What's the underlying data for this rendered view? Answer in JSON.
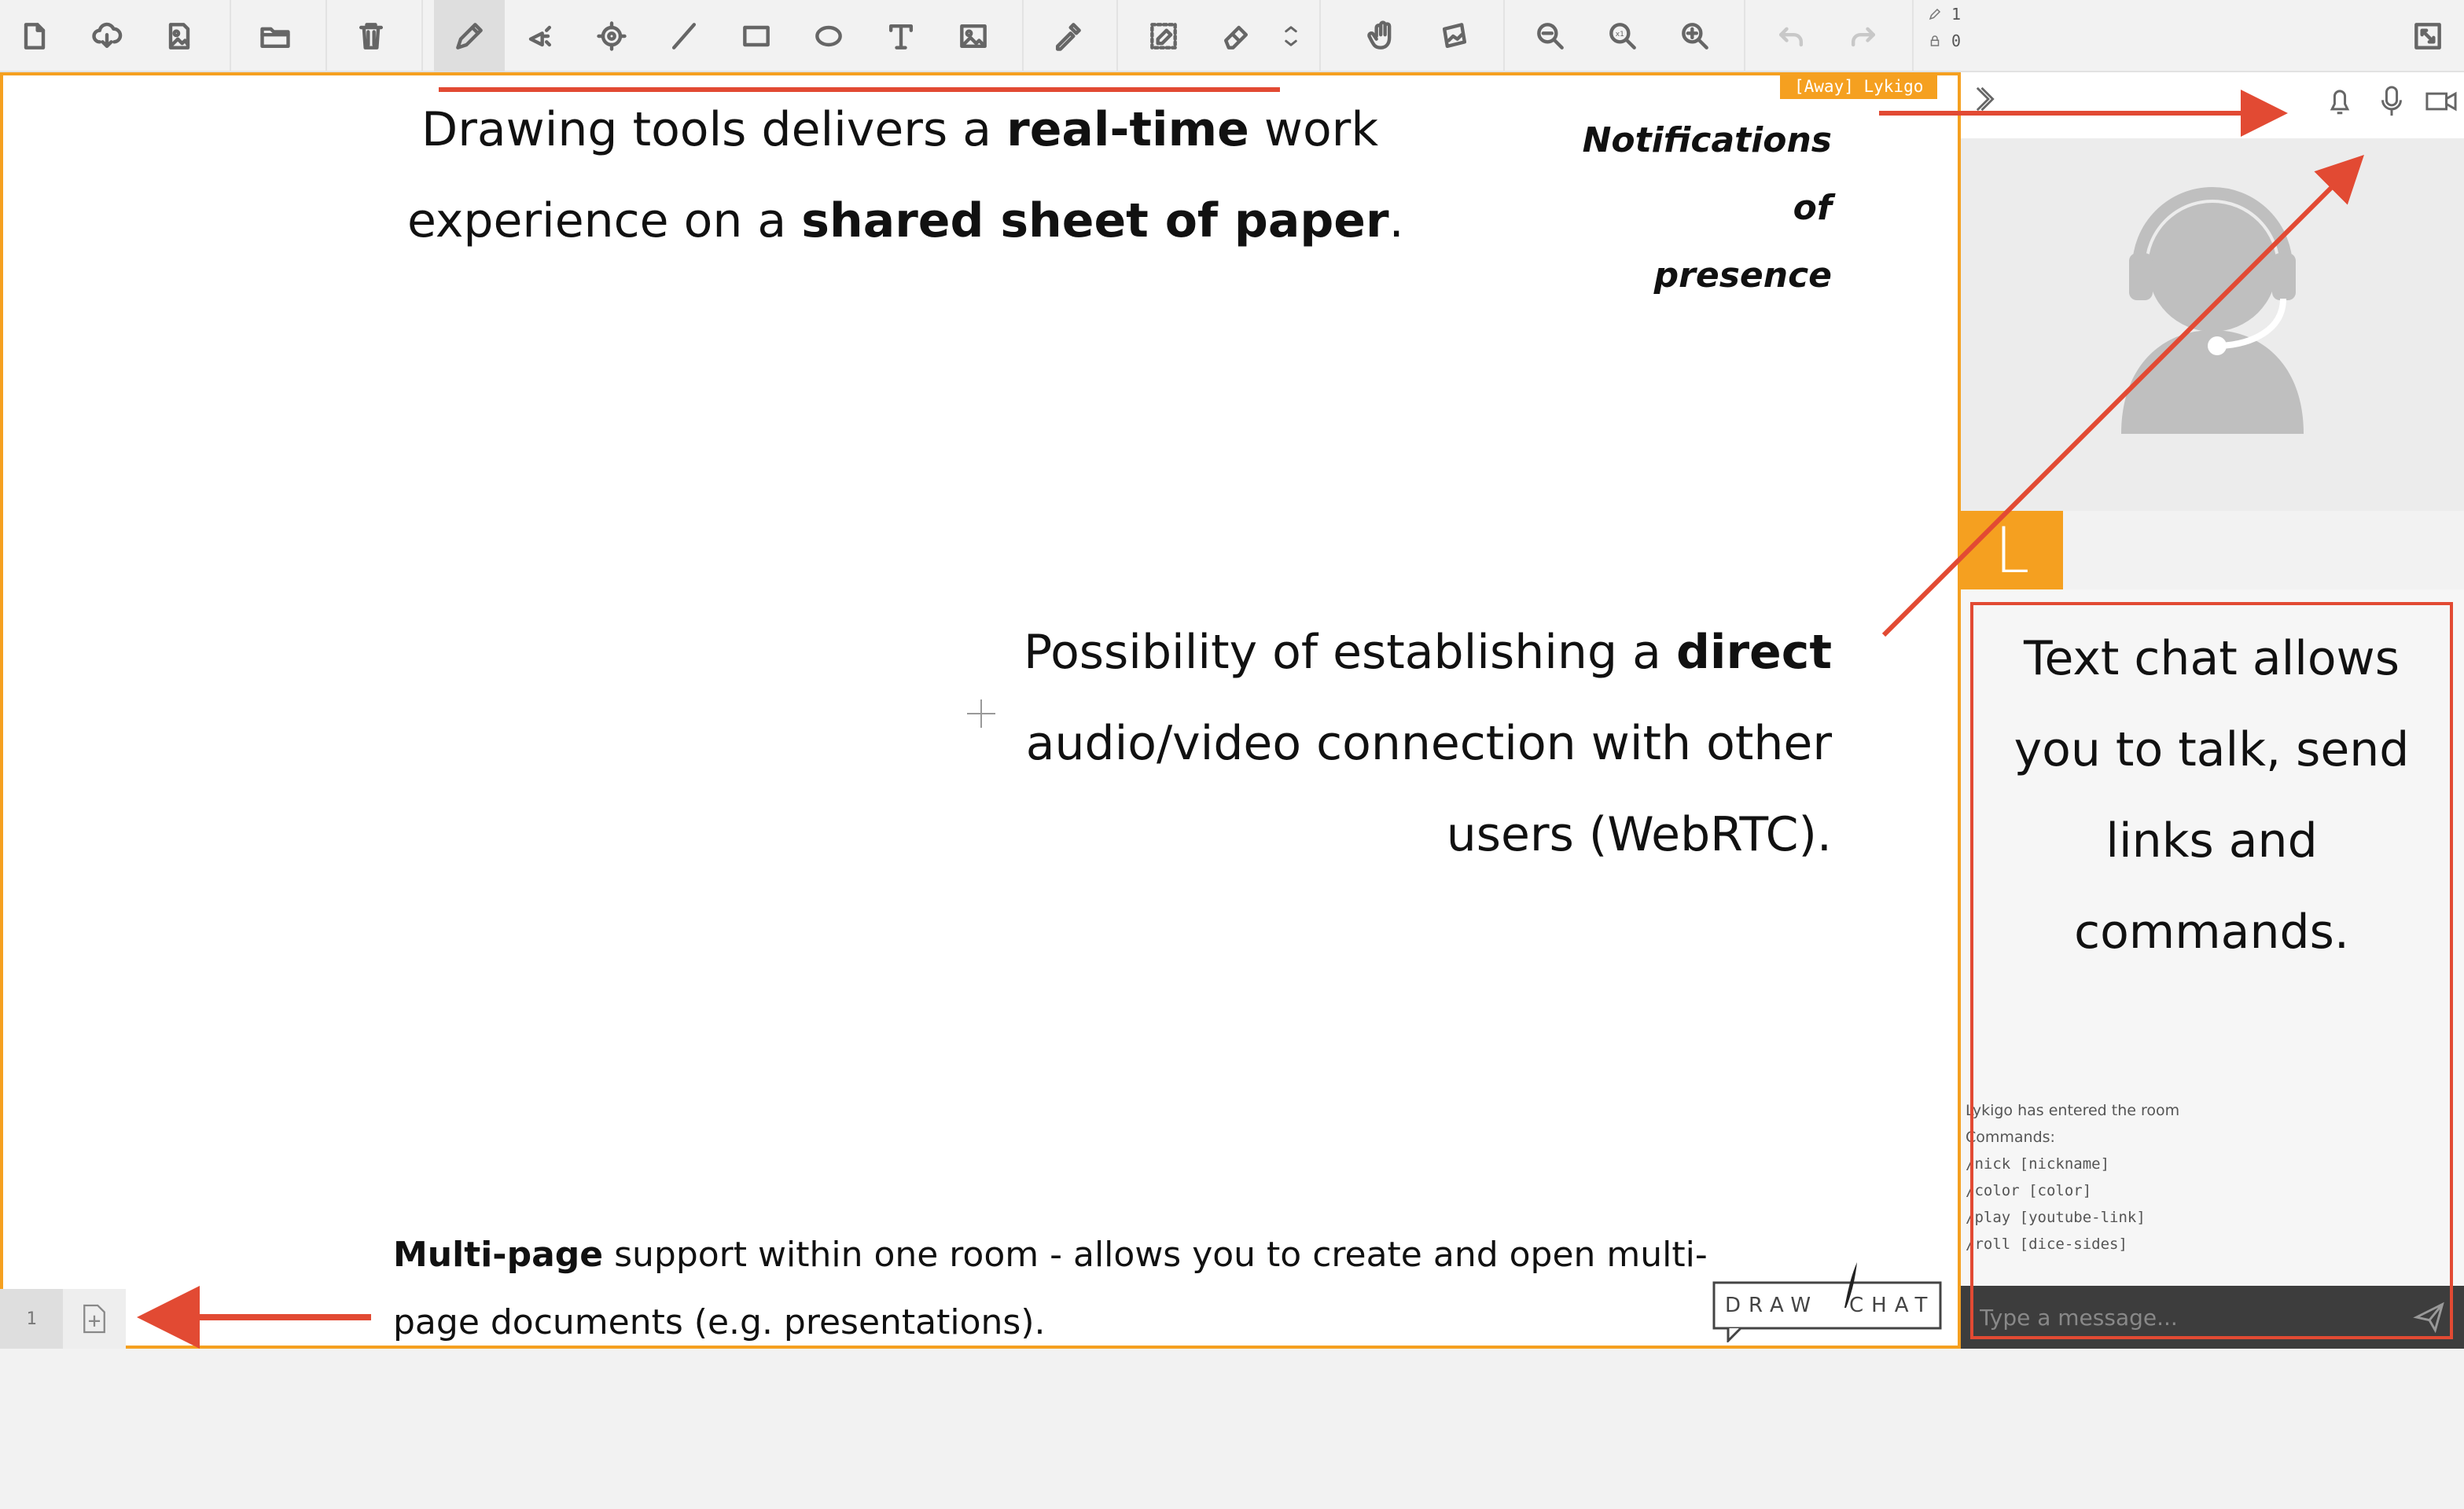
{
  "toolbar": {
    "left_tools": [
      {
        "name": "new-document-icon"
      },
      {
        "name": "cloud-download-icon"
      },
      {
        "name": "image-export-icon"
      },
      {
        "name": "folder-open-icon"
      },
      {
        "name": "trash-icon"
      },
      {
        "name": "pencil-icon",
        "active": true
      },
      {
        "name": "spray-icon"
      },
      {
        "name": "brush-icon"
      },
      {
        "name": "line-icon"
      },
      {
        "name": "rectangle-icon"
      },
      {
        "name": "ellipse-icon"
      },
      {
        "name": "text-icon"
      },
      {
        "name": "image-insert-icon"
      },
      {
        "name": "eyedropper-icon"
      },
      {
        "name": "selection-eraser-icon"
      },
      {
        "name": "eraser-icon"
      },
      {
        "name": "arrow-up-down-icon"
      },
      {
        "name": "hand-icon"
      },
      {
        "name": "image-move-icon"
      },
      {
        "name": "zoom-out-icon"
      },
      {
        "name": "zoom-reset-icon"
      },
      {
        "name": "zoom-in-icon"
      },
      {
        "name": "undo-icon"
      },
      {
        "name": "redo-icon"
      }
    ],
    "pencil_count": "1",
    "lock_count": "0",
    "fullscreen_icon": "fullscreen-icon"
  },
  "canvas": {
    "nick_tag": "[Away] Lykigo",
    "notes": {
      "drawing_1a": "Drawing tools delivers a ",
      "drawing_1b": "real-time",
      "drawing_1c": " work",
      "drawing_2a": "experience on a ",
      "drawing_2b": "shared sheet of paper",
      "drawing_2c": ".",
      "notify_1": "Notifications of",
      "notify_2": "presence",
      "direct_1a": "Possibility of establishing a ",
      "direct_1b": "direct",
      "direct_2": "audio/video connection with other",
      "direct_3": "users (WebRTC).",
      "multi_1a": "Multi-page",
      "multi_1b": " support within one room - allows you to create and open multi-",
      "multi_2": "page documents (e.g. presentations)."
    },
    "logo_text_left": "DRAW",
    "logo_text_right": "CHAT"
  },
  "pagebar": {
    "page_number": "1"
  },
  "panel": {
    "user_initial": "L",
    "chat_note": [
      "Text chat allows",
      "you to talk, send",
      "links and",
      "commands."
    ],
    "chat_messages": [
      {
        "text": "Lykigo has entered the room",
        "mono": false
      },
      {
        "text": "Commands:",
        "mono": false
      },
      {
        "text": "/nick [nickname]",
        "mono": true
      },
      {
        "text": "/color [color]",
        "mono": true
      },
      {
        "text": "/play [youtube-link]",
        "mono": true
      },
      {
        "text": "/roll [dice-sides]",
        "mono": true
      }
    ],
    "input_placeholder": "Type a message..."
  },
  "colors": {
    "accent": "#f5a020",
    "annotation_red": "#e24a33"
  }
}
